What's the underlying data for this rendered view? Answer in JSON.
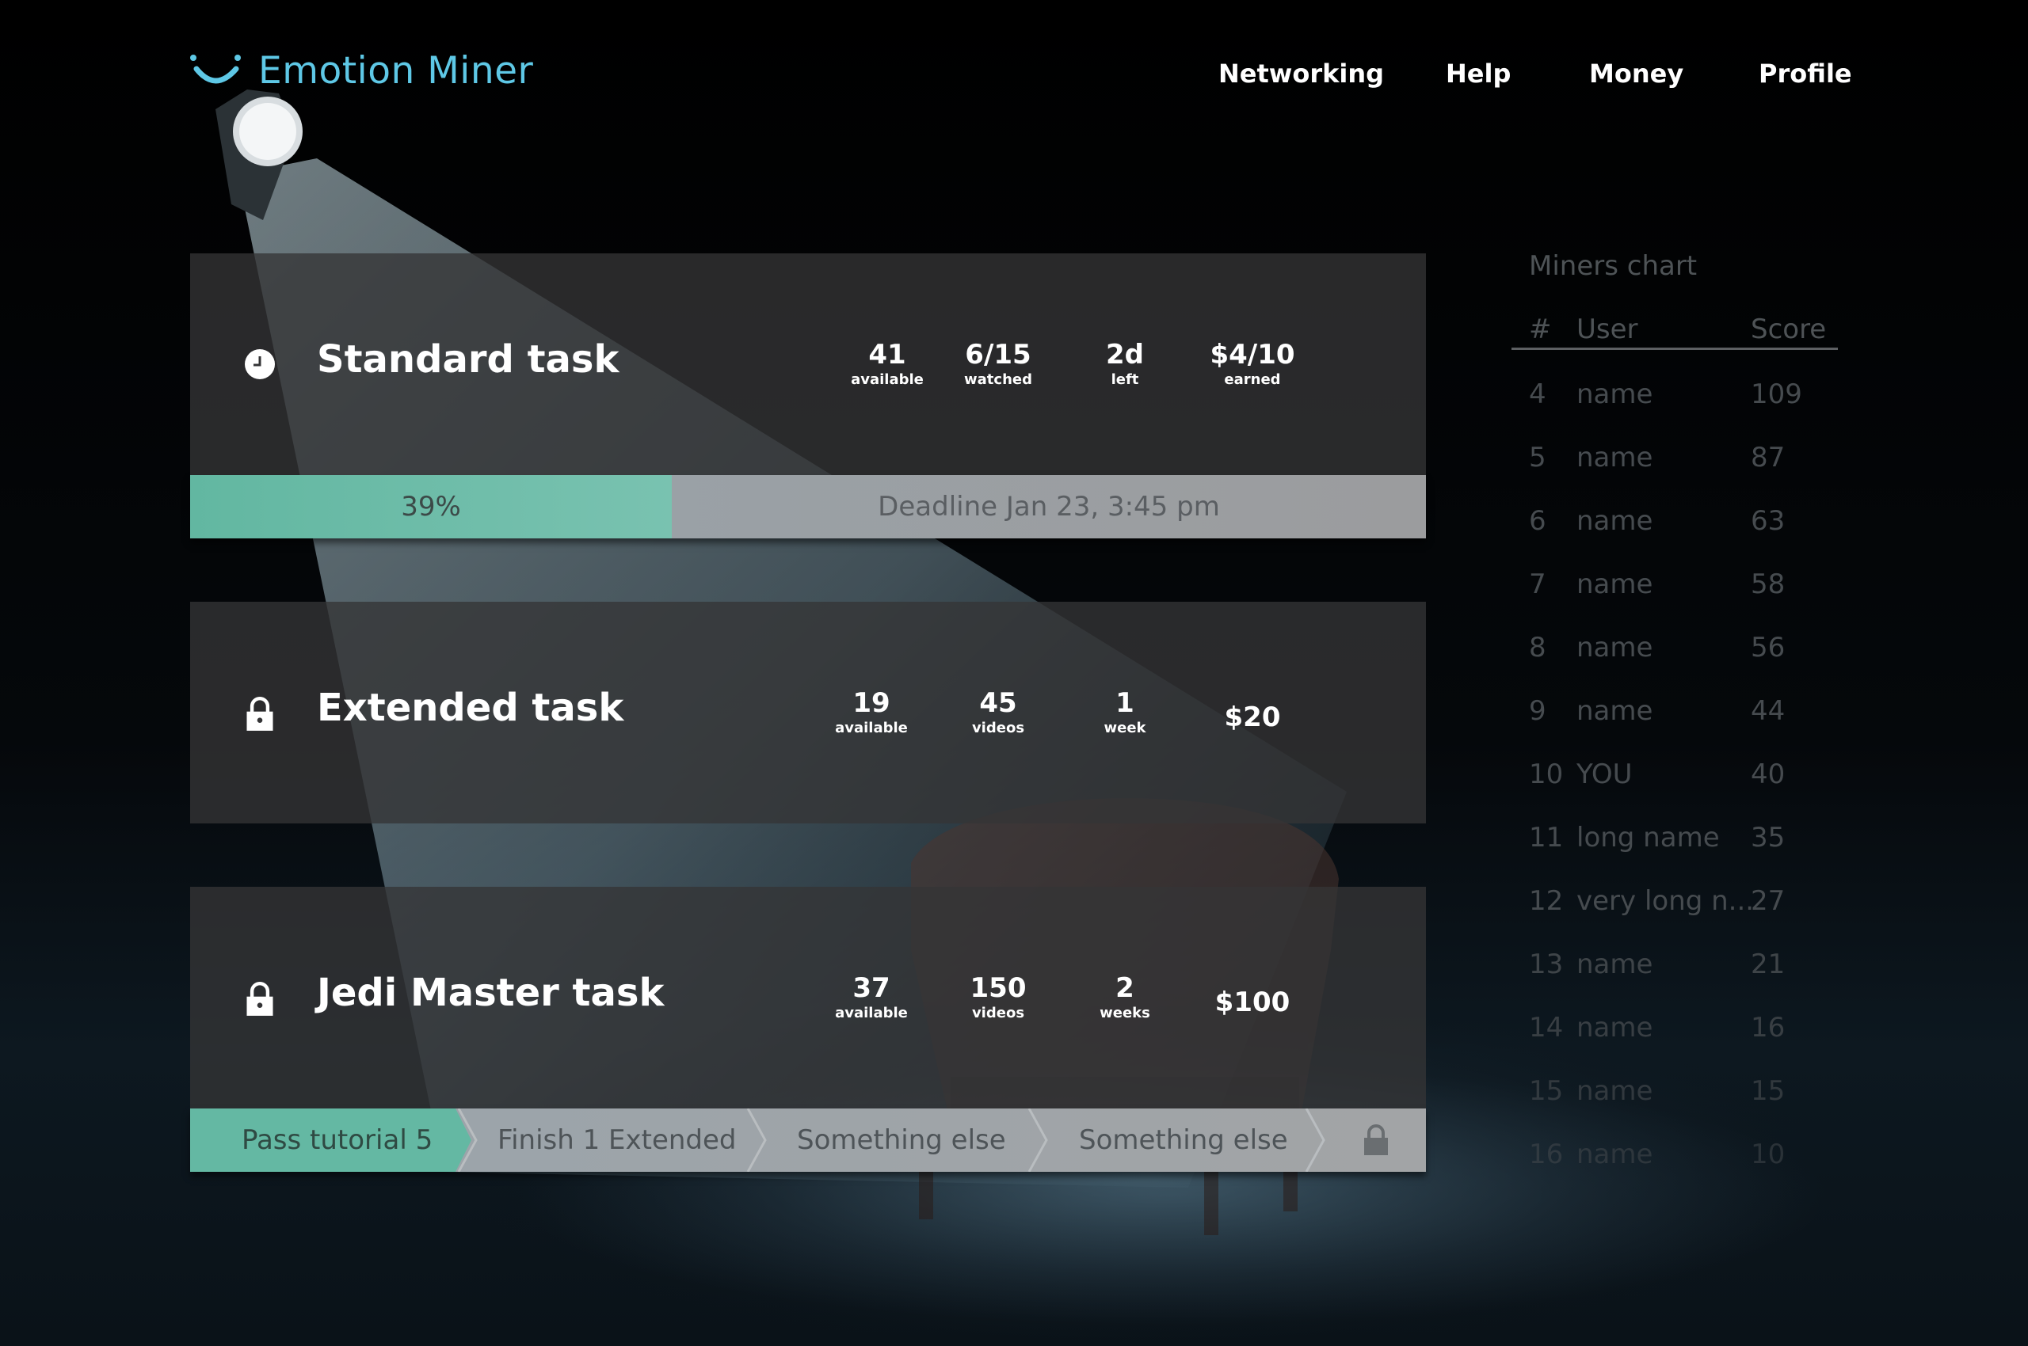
{
  "app": {
    "name": "Emotion Miner"
  },
  "nav": [
    "Networking",
    "Help",
    "Money",
    "Profile"
  ],
  "tasks": [
    {
      "title": "Standard task",
      "icon": "clock-icon",
      "stats": [
        {
          "value": "41",
          "label": "available"
        },
        {
          "value": "6/15",
          "label": "watched"
        },
        {
          "value": "2d",
          "label": "left"
        },
        {
          "value": "$4/10",
          "label": "earned"
        }
      ],
      "progress": {
        "percent": 39,
        "label": "39%",
        "deadline": "Deadline Jan 23, 3:45 pm"
      }
    },
    {
      "title": "Extended task",
      "icon": "lock-icon",
      "stats": [
        {
          "value": "19",
          "label": "available"
        },
        {
          "value": "45",
          "label": "videos"
        },
        {
          "value": "1",
          "label": "week"
        },
        {
          "value": "$20",
          "label": ""
        }
      ]
    },
    {
      "title": "Jedi Master task",
      "icon": "lock-icon",
      "stats": [
        {
          "value": "37",
          "label": "available"
        },
        {
          "value": "150",
          "label": "videos"
        },
        {
          "value": "2",
          "label": "weeks"
        },
        {
          "value": "$100",
          "label": ""
        }
      ],
      "requirements": [
        "Pass tutorial 5",
        "Finish 1 Extended",
        "Something else",
        "Something else"
      ]
    }
  ],
  "leaderboard": {
    "title": "Miners chart",
    "columns": [
      "#",
      "User",
      "Score"
    ],
    "rows": [
      {
        "rank": "4",
        "user": "name",
        "score": "109"
      },
      {
        "rank": "5",
        "user": "name",
        "score": "87"
      },
      {
        "rank": "6",
        "user": "name",
        "score": "63"
      },
      {
        "rank": "7",
        "user": "name",
        "score": "58"
      },
      {
        "rank": "8",
        "user": "name",
        "score": "56"
      },
      {
        "rank": "9",
        "user": "name",
        "score": "44"
      },
      {
        "rank": "10",
        "user": "YOU",
        "score": "40"
      },
      {
        "rank": "11",
        "user": "long name",
        "score": "35"
      },
      {
        "rank": "12",
        "user": "very long n...",
        "score": "27"
      },
      {
        "rank": "13",
        "user": "name",
        "score": "21"
      },
      {
        "rank": "14",
        "user": "name",
        "score": "16"
      },
      {
        "rank": "15",
        "user": "name",
        "score": "15"
      },
      {
        "rank": "16",
        "user": "name",
        "score": "10"
      }
    ]
  },
  "colors": {
    "accent": "#5ec8e6",
    "progress": "#6bbca7",
    "card": "#343436"
  }
}
